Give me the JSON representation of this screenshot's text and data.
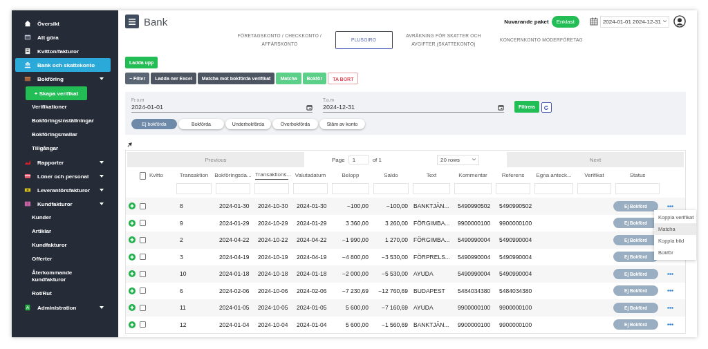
{
  "sidebar": {
    "items": [
      {
        "label": "Översikt",
        "selected": false
      },
      {
        "label": "Att göra",
        "selected": false
      },
      {
        "label": "Kvitton/fakturor",
        "selected": false
      },
      {
        "label": "Bank och skattekonto",
        "selected": true
      },
      {
        "label": "Bokföring",
        "selected": false,
        "kind": "group",
        "children": [
          {
            "kind": "button",
            "label": "+ Skapa verifikat"
          },
          {
            "kind": "link",
            "label": "Verifikationer"
          },
          {
            "kind": "link",
            "label": "Bokföringsinställningar"
          },
          {
            "kind": "link",
            "label": "Bokföringsmallar"
          },
          {
            "kind": "link",
            "label": "Tillgångar"
          }
        ]
      },
      {
        "label": "Rapporter",
        "selected": false,
        "kind": "group"
      },
      {
        "label": "Löner och personal",
        "selected": false,
        "kind": "group"
      },
      {
        "label": "Leverantörsfakturor",
        "selected": false,
        "kind": "group"
      },
      {
        "label": "Kundfakturor",
        "selected": false,
        "kind": "group",
        "children": [
          {
            "kind": "link",
            "label": "Kunder"
          },
          {
            "kind": "link",
            "label": "Artiklar"
          },
          {
            "kind": "link",
            "label": "Kundfakturor"
          },
          {
            "kind": "link",
            "label": "Offerter"
          },
          {
            "kind": "link",
            "label": "Återkommande kundfakturor"
          },
          {
            "kind": "link",
            "label": "Rot/Rut"
          }
        ]
      },
      {
        "label": "Administration",
        "selected": false,
        "kind": "group"
      }
    ]
  },
  "header": {
    "title": "Bank",
    "package_label": "Nuvarande paket",
    "package": "Enklast",
    "date_range": "2024-01-01 2024-12-31"
  },
  "tabs": [
    {
      "label": "FÖRETAGSKONTO / CHECKKONTO / AFFÄRSKONTO",
      "selected": false
    },
    {
      "label": "PLUSGIRO",
      "selected": true
    },
    {
      "label": "AVRÄKNING FÖR SKATTER OCH AVGIFTER (SKATTEKONTO)",
      "selected": false
    },
    {
      "label": "KONCERNKONTO MODERFÖRETAG",
      "selected": false
    }
  ],
  "upload_button": "Ladda upp",
  "toolbar": [
    {
      "label": "− Filter",
      "kind": "secondary"
    },
    {
      "label": "Ladda ner Excel",
      "kind": "dark"
    },
    {
      "label": "Matcha mot bokförda verifikat",
      "kind": "dark"
    },
    {
      "label": "Matcha",
      "kind": "success"
    },
    {
      "label": "Bokför",
      "kind": "success"
    },
    {
      "label": "TA BORT",
      "kind": "danger"
    }
  ],
  "filter": {
    "from": {
      "label": "Fr.o.m",
      "value": "2024-01-01"
    },
    "to": {
      "label": "T.o.m",
      "value": "2024-12-31"
    },
    "button": "Filtrera"
  },
  "status_pills": [
    {
      "label": "Ej bokförda",
      "selected": true
    },
    {
      "label": "Bokförda",
      "selected": false
    },
    {
      "label": "Underbokförda",
      "selected": false
    },
    {
      "label": "Överbokförda",
      "selected": false
    },
    {
      "label": "Stäm av konto",
      "selected": false
    }
  ],
  "pagination": {
    "previous": "Previous",
    "page_label": "Page",
    "page": "1",
    "of": "of 1",
    "rows": "20 rows",
    "next": "Next"
  },
  "table": {
    "select_all_checked": false,
    "columns": [
      {
        "label": "Kvitto",
        "sorted": false
      },
      {
        "label": "Transaktion",
        "sorted": false
      },
      {
        "label": "Bokföringsda...",
        "sorted": false
      },
      {
        "label": "Transaktions...",
        "sorted": true
      },
      {
        "label": "Valutadatum",
        "sorted": false
      },
      {
        "label": "Belopp",
        "sorted": false
      },
      {
        "label": "Saldo",
        "sorted": false
      },
      {
        "label": "Text",
        "sorted": false
      },
      {
        "label": "Kommentar",
        "sorted": false
      },
      {
        "label": "Referens",
        "sorted": false
      },
      {
        "label": "Egna anteck...",
        "sorted": false
      },
      {
        "label": "Verifikat",
        "sorted": false
      },
      {
        "label": "Status",
        "sorted": false
      }
    ],
    "rows": [
      {
        "checked": false,
        "transaction": "8",
        "booking_date": "2024-01-30",
        "transaction_date": "2024-10-30",
        "value_date": "2024-01-30",
        "amount": "−100,00",
        "balance": "−100,00",
        "text": "BANKTJÄN...",
        "comment": "5490990502",
        "reference": "5490990502",
        "status": "Ej Bokförd",
        "menu": [
          {
            "label": "Koppla verifikat",
            "selected": false
          },
          {
            "label": "Matcha",
            "selected": true
          },
          {
            "label": "Koppla bild",
            "selected": false
          },
          {
            "label": "Bokför",
            "selected": false
          }
        ]
      },
      {
        "checked": false,
        "transaction": "9",
        "booking_date": "2024-01-29",
        "transaction_date": "2024-10-29",
        "value_date": "2024-01-29",
        "amount": "3 360,00",
        "balance": "3 260,00",
        "text": "FÖRGIMBA...",
        "comment": "9900000100",
        "reference": "9900000100",
        "status": "Ej Bokförd"
      },
      {
        "checked": false,
        "transaction": "2",
        "booking_date": "2024-04-22",
        "transaction_date": "2024-10-22",
        "value_date": "2024-04-22",
        "amount": "−1 990,00",
        "balance": "1 270,00",
        "text": "FÖRGIMBA...",
        "comment": "5490990004",
        "reference": "5490990004",
        "status": "Ej Bokförd"
      },
      {
        "checked": false,
        "transaction": "3",
        "booking_date": "2024-04-19",
        "transaction_date": "2024-10-19",
        "value_date": "2024-04-19",
        "amount": "−4 800,00",
        "balance": "−3 530,00",
        "text": "FÖRPRELS...",
        "comment": "5490990004",
        "reference": "5490990004",
        "status": "Ej Bokförd"
      },
      {
        "checked": false,
        "transaction": "10",
        "booking_date": "2024-01-18",
        "transaction_date": "2024-10-18",
        "value_date": "2024-01-18",
        "amount": "−2 000,00",
        "balance": "−5 530,00",
        "text": "AYUDA",
        "comment": "5490990004",
        "reference": "5490990004",
        "status": "Ej Bokförd"
      },
      {
        "checked": false,
        "transaction": "6",
        "booking_date": "2024-02-06",
        "transaction_date": "2024-10-06",
        "value_date": "2024-02-06",
        "amount": "−7 230,69",
        "balance": "−12 760,69",
        "text": "BUDAPEST",
        "comment": "5484034380",
        "reference": "5484034380",
        "status": "Ej Bokförd"
      },
      {
        "checked": false,
        "transaction": "11",
        "booking_date": "2024-01-05",
        "transaction_date": "2024-10-05",
        "value_date": "2024-01-05",
        "amount": "5 600,00",
        "balance": "−7 160,69",
        "text": "AYUDA",
        "comment": "9900000100",
        "reference": "9900000100",
        "status": "Ej Bokförd"
      },
      {
        "checked": false,
        "transaction": "12",
        "booking_date": "2024-01-04",
        "transaction_date": "2024-10-04",
        "value_date": "2024-01-04",
        "amount": "5 600,00",
        "balance": "−1 560,69",
        "text": "BANKTJÄN...",
        "comment": "9900000100",
        "reference": "9900000100",
        "status": "Ej Bokförd"
      }
    ]
  }
}
